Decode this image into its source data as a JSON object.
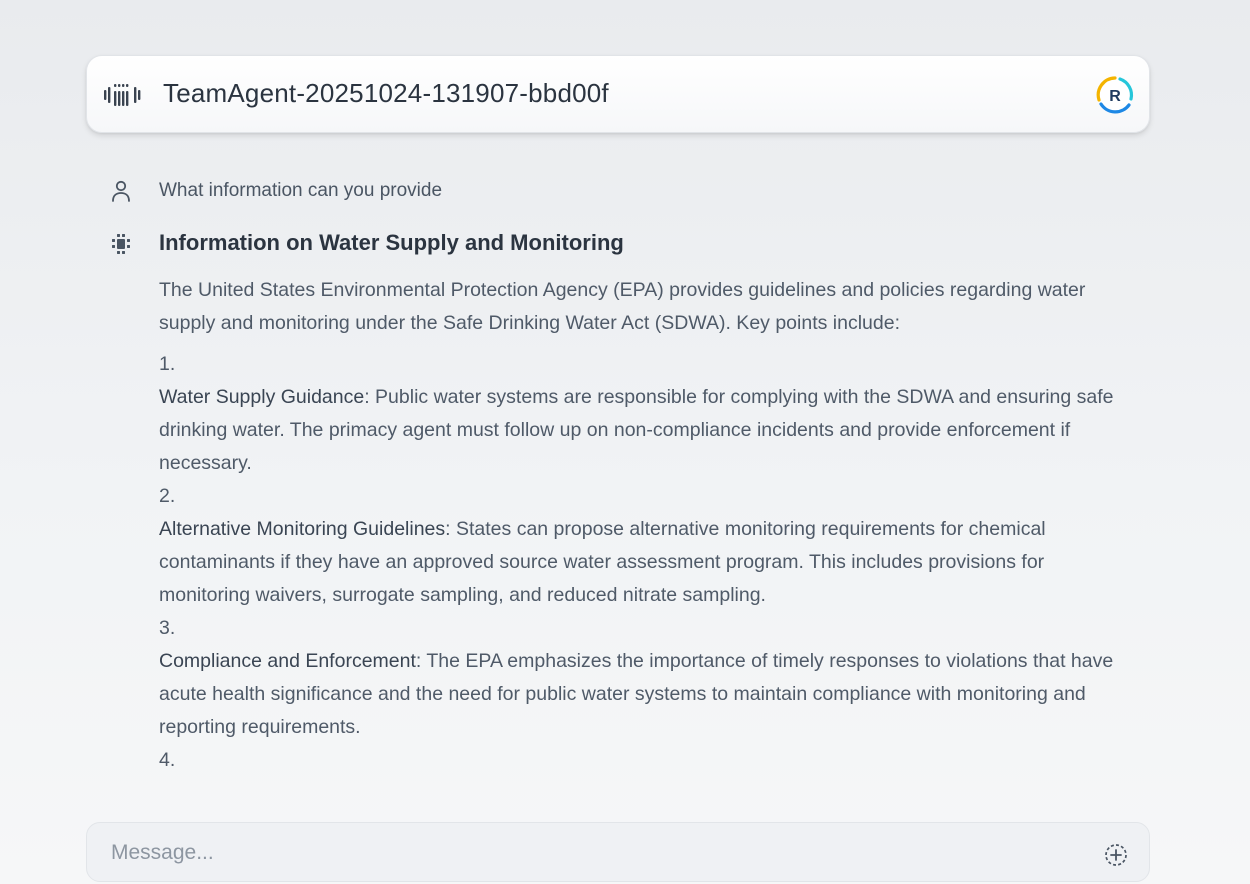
{
  "header": {
    "title": "TeamAgent-20251024-131907-bbd00f",
    "logo_icon": "agent-logo-icon",
    "avatar_letter": "R",
    "avatar_colors": [
      "#f4b400",
      "#1e88e5",
      "#26c6da"
    ]
  },
  "conversation": {
    "user_message": "What information can you provide",
    "answer": {
      "title": "Information on Water Supply and Monitoring",
      "intro": "The United States Environmental Protection Agency (EPA) provides guidelines and policies regarding water supply and monitoring under the Safe Drinking Water Act (SDWA). Key points include:",
      "items": [
        {
          "number": "1.",
          "label": "Water Supply Guidance",
          "text": ": Public water systems are responsible for complying with the SDWA and ensuring safe drinking water. The primacy agent must follow up on non-compliance incidents and provide enforcement if necessary."
        },
        {
          "number": "2.",
          "label": "Alternative Monitoring Guidelines",
          "text": ": States can propose alternative monitoring requirements for chemical contaminants if they have an approved source water assessment program. This includes provisions for monitoring waivers, surrogate sampling, and reduced nitrate sampling."
        },
        {
          "number": "3.",
          "label": "Compliance and Enforcement",
          "text": ": The EPA emphasizes the importance of timely responses to violations that have acute health significance and the need for public water systems to maintain compliance with monitoring and reporting requirements."
        },
        {
          "number": "4.",
          "label": "",
          "text": ""
        }
      ]
    }
  },
  "composer": {
    "placeholder": "Message...",
    "value": "",
    "attach_icon": "plus-circle-icon"
  },
  "icons": {
    "user": "user-icon",
    "assistant": "assistant-icon"
  }
}
